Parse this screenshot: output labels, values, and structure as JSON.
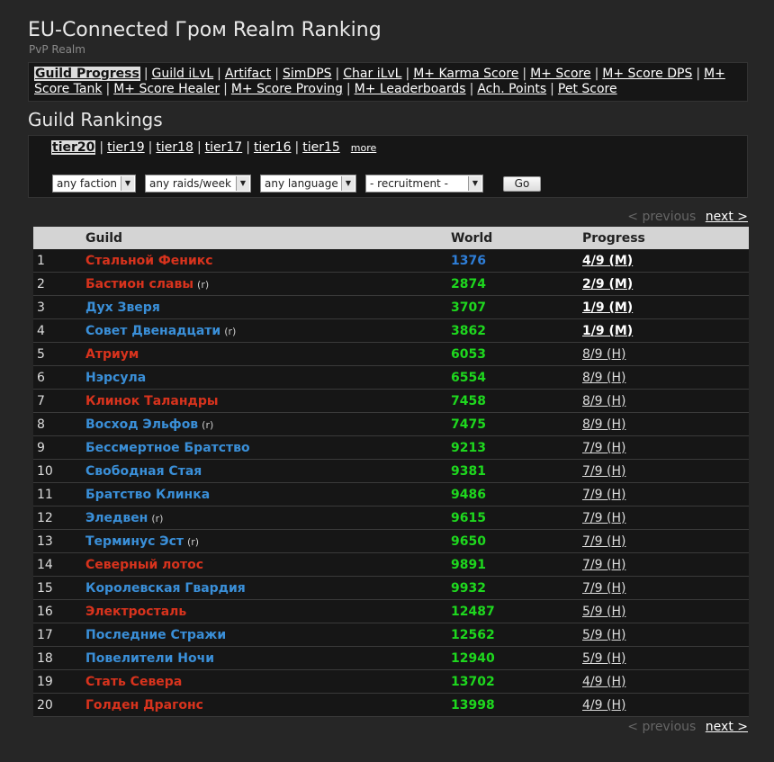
{
  "header": {
    "title": "EU-Connected Гром Realm Ranking",
    "subtitle": "PvP Realm"
  },
  "nav": {
    "items": [
      {
        "label": "Guild Progress",
        "active": true
      },
      {
        "label": "Guild iLvL"
      },
      {
        "label": "Artifact"
      },
      {
        "label": "SimDPS"
      },
      {
        "label": "Char iLvL"
      },
      {
        "label": "M+ Karma Score"
      },
      {
        "label": "M+ Score"
      },
      {
        "label": "M+ Score DPS"
      },
      {
        "label": "M+ Score Tank"
      },
      {
        "label": "M+ Score Healer"
      },
      {
        "label": "M+ Score Proving"
      },
      {
        "label": "M+ Leaderboards"
      },
      {
        "label": "Ach. Points"
      },
      {
        "label": "Pet Score"
      }
    ]
  },
  "section_title": "Guild Rankings",
  "tiers": {
    "items": [
      "tier20",
      "tier19",
      "tier18",
      "tier17",
      "tier16",
      "tier15"
    ],
    "more": "more"
  },
  "filters": {
    "faction": "any faction",
    "raids": "any raids/week",
    "language": "any language",
    "recruitment": "- recruitment -",
    "go": "Go"
  },
  "pager": {
    "prev": "< previous",
    "next": "next >"
  },
  "table": {
    "headers": {
      "guild": "Guild",
      "world": "World",
      "progress": "Progress"
    },
    "r_tag": "(r)",
    "rows": [
      {
        "rank": "1",
        "guild": "Стальной Феникс",
        "faction": "horde",
        "r": false,
        "world": "1376",
        "progress": "4/9 (M)"
      },
      {
        "rank": "2",
        "guild": "Бастион славы",
        "faction": "horde",
        "r": true,
        "world": "2874",
        "progress": "2/9 (M)"
      },
      {
        "rank": "3",
        "guild": "Дух Зверя",
        "faction": "alliance",
        "r": false,
        "world": "3707",
        "progress": "1/9 (M)"
      },
      {
        "rank": "4",
        "guild": "Совет Двенадцати",
        "faction": "alliance",
        "r": true,
        "world": "3862",
        "progress": "1/9 (M)"
      },
      {
        "rank": "5",
        "guild": "Атриум",
        "faction": "horde",
        "r": false,
        "world": "6053",
        "progress": "8/9 (H)"
      },
      {
        "rank": "6",
        "guild": "Нэрсула",
        "faction": "alliance",
        "r": false,
        "world": "6554",
        "progress": "8/9 (H)"
      },
      {
        "rank": "7",
        "guild": "Клинок Таландры",
        "faction": "horde",
        "r": false,
        "world": "7458",
        "progress": "8/9 (H)"
      },
      {
        "rank": "8",
        "guild": "Восход Эльфов",
        "faction": "alliance",
        "r": true,
        "world": "7475",
        "progress": "8/9 (H)"
      },
      {
        "rank": "9",
        "guild": "Бессмертное Братство",
        "faction": "alliance",
        "r": false,
        "world": "9213",
        "progress": "7/9 (H)"
      },
      {
        "rank": "10",
        "guild": "Свободная Стая",
        "faction": "alliance",
        "r": false,
        "world": "9381",
        "progress": "7/9 (H)"
      },
      {
        "rank": "11",
        "guild": "Братство Клинка",
        "faction": "alliance",
        "r": false,
        "world": "9486",
        "progress": "7/9 (H)"
      },
      {
        "rank": "12",
        "guild": "Элeдвен",
        "faction": "alliance",
        "r": true,
        "world": "9615",
        "progress": "7/9 (H)"
      },
      {
        "rank": "13",
        "guild": "Терминус Эст",
        "faction": "alliance",
        "r": true,
        "world": "9650",
        "progress": "7/9 (H)"
      },
      {
        "rank": "14",
        "guild": "Северный лотос",
        "faction": "horde",
        "r": false,
        "world": "9891",
        "progress": "7/9 (H)"
      },
      {
        "rank": "15",
        "guild": "Королевская Гвардия",
        "faction": "alliance",
        "r": false,
        "world": "9932",
        "progress": "7/9 (H)"
      },
      {
        "rank": "16",
        "guild": "Электросталь",
        "faction": "horde",
        "r": false,
        "world": "12487",
        "progress": "5/9 (H)"
      },
      {
        "rank": "17",
        "guild": "Последние Стражи",
        "faction": "alliance",
        "r": false,
        "world": "12562",
        "progress": "5/9 (H)"
      },
      {
        "rank": "18",
        "guild": "Повелители Ночи",
        "faction": "alliance",
        "r": false,
        "world": "12940",
        "progress": "5/9 (H)"
      },
      {
        "rank": "19",
        "guild": "Стать Севера",
        "faction": "horde",
        "r": false,
        "world": "13702",
        "progress": "4/9 (H)"
      },
      {
        "rank": "20",
        "guild": "Голден Драгонс",
        "faction": "horde",
        "r": false,
        "world": "13998",
        "progress": "4/9 (H)"
      }
    ]
  },
  "colors": {
    "horde": "#d8331d",
    "alliance": "#3a8fd8",
    "world_rank": "#1ed81e",
    "world_top": "#2e7ed8"
  }
}
